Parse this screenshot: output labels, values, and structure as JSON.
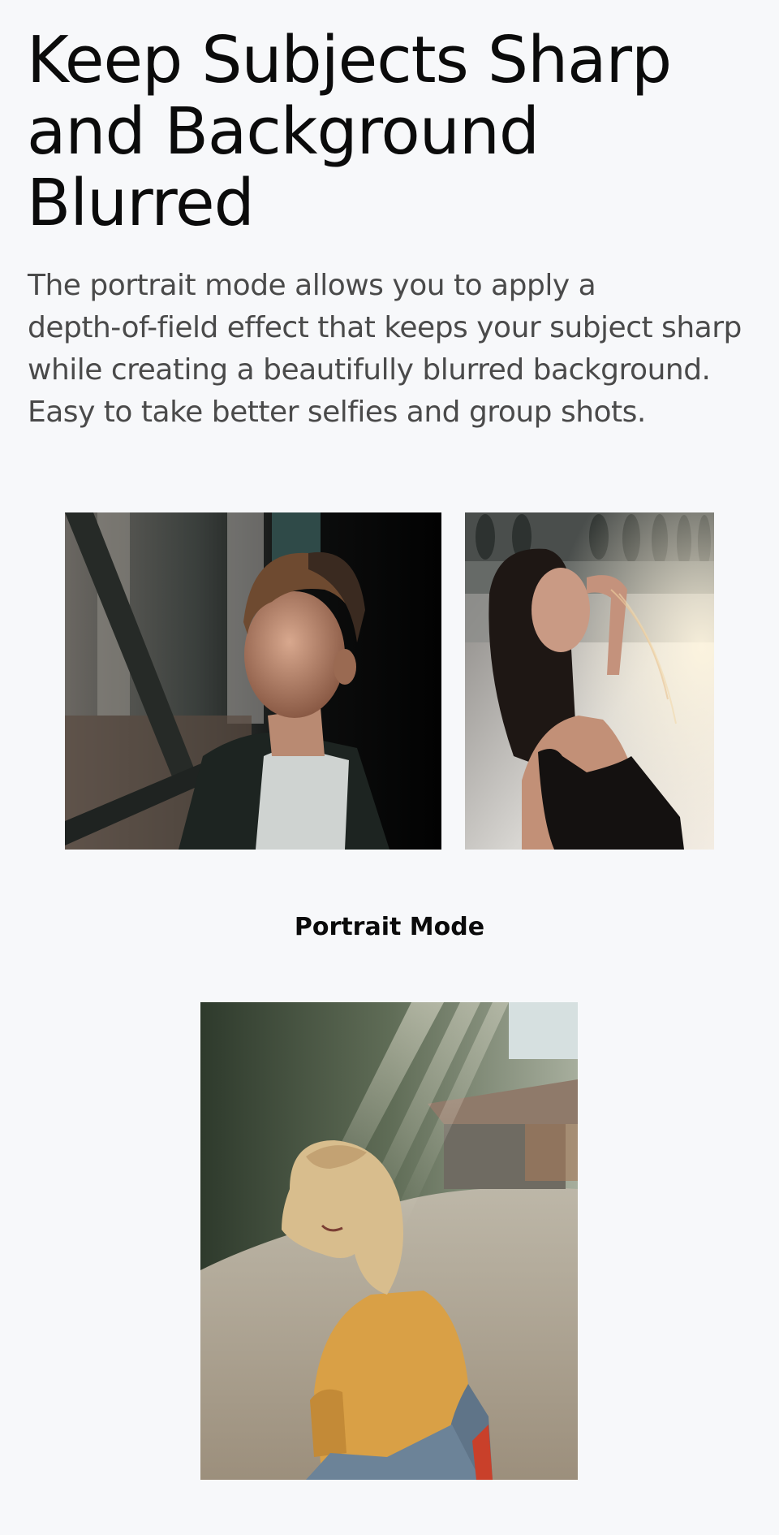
{
  "section": {
    "headline_line1": "Keep Subjects Sharp",
    "headline_line2": "and Background",
    "headline_line3": "Blurred",
    "description_line1": "The portrait mode allows you to apply a",
    "description_line2": "depth-of-field effect that keeps your subject sharp",
    "description_line3": "while creating a beautifully blurred background.",
    "description_line4": "Easy to take better selfies and group shots."
  },
  "gallery": {
    "caption": "Portrait Mode",
    "photos": [
      {
        "icon": "portrait-boy-photo"
      },
      {
        "icon": "portrait-woman-photo"
      },
      {
        "icon": "portrait-girl-photo"
      }
    ]
  },
  "colors": {
    "background": "#f7f8fa",
    "headline": "#0b0b0b",
    "body_text": "#4a4a4a"
  }
}
